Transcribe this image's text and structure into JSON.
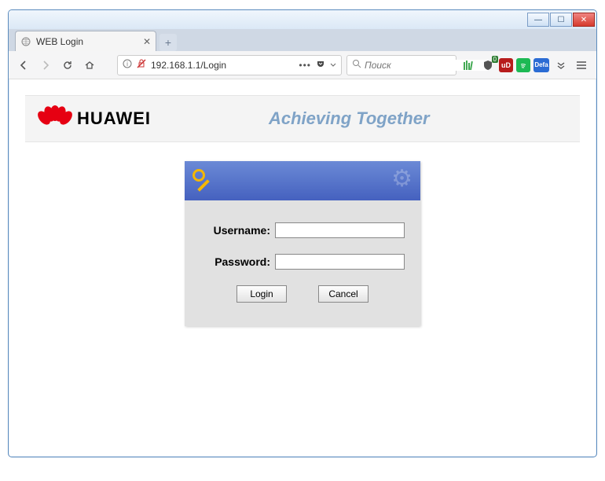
{
  "window": {
    "minimize": "—",
    "maximize": "☐",
    "close": "✕"
  },
  "tab": {
    "title": "WEB Login",
    "close": "✕",
    "newtab": "+"
  },
  "toolbar": {
    "url_value": "192.168.1.1/Login",
    "search_placeholder": "Поиск",
    "ext_defa": "Defa",
    "ext_ub": "uD",
    "ext_books_badge": "0"
  },
  "header": {
    "brand": "HUAWEI",
    "tagline": "Achieving Together"
  },
  "login": {
    "username_label": "Username:",
    "username_value": "",
    "password_label": "Password:",
    "password_value": "",
    "login_btn": "Login",
    "cancel_btn": "Cancel"
  }
}
